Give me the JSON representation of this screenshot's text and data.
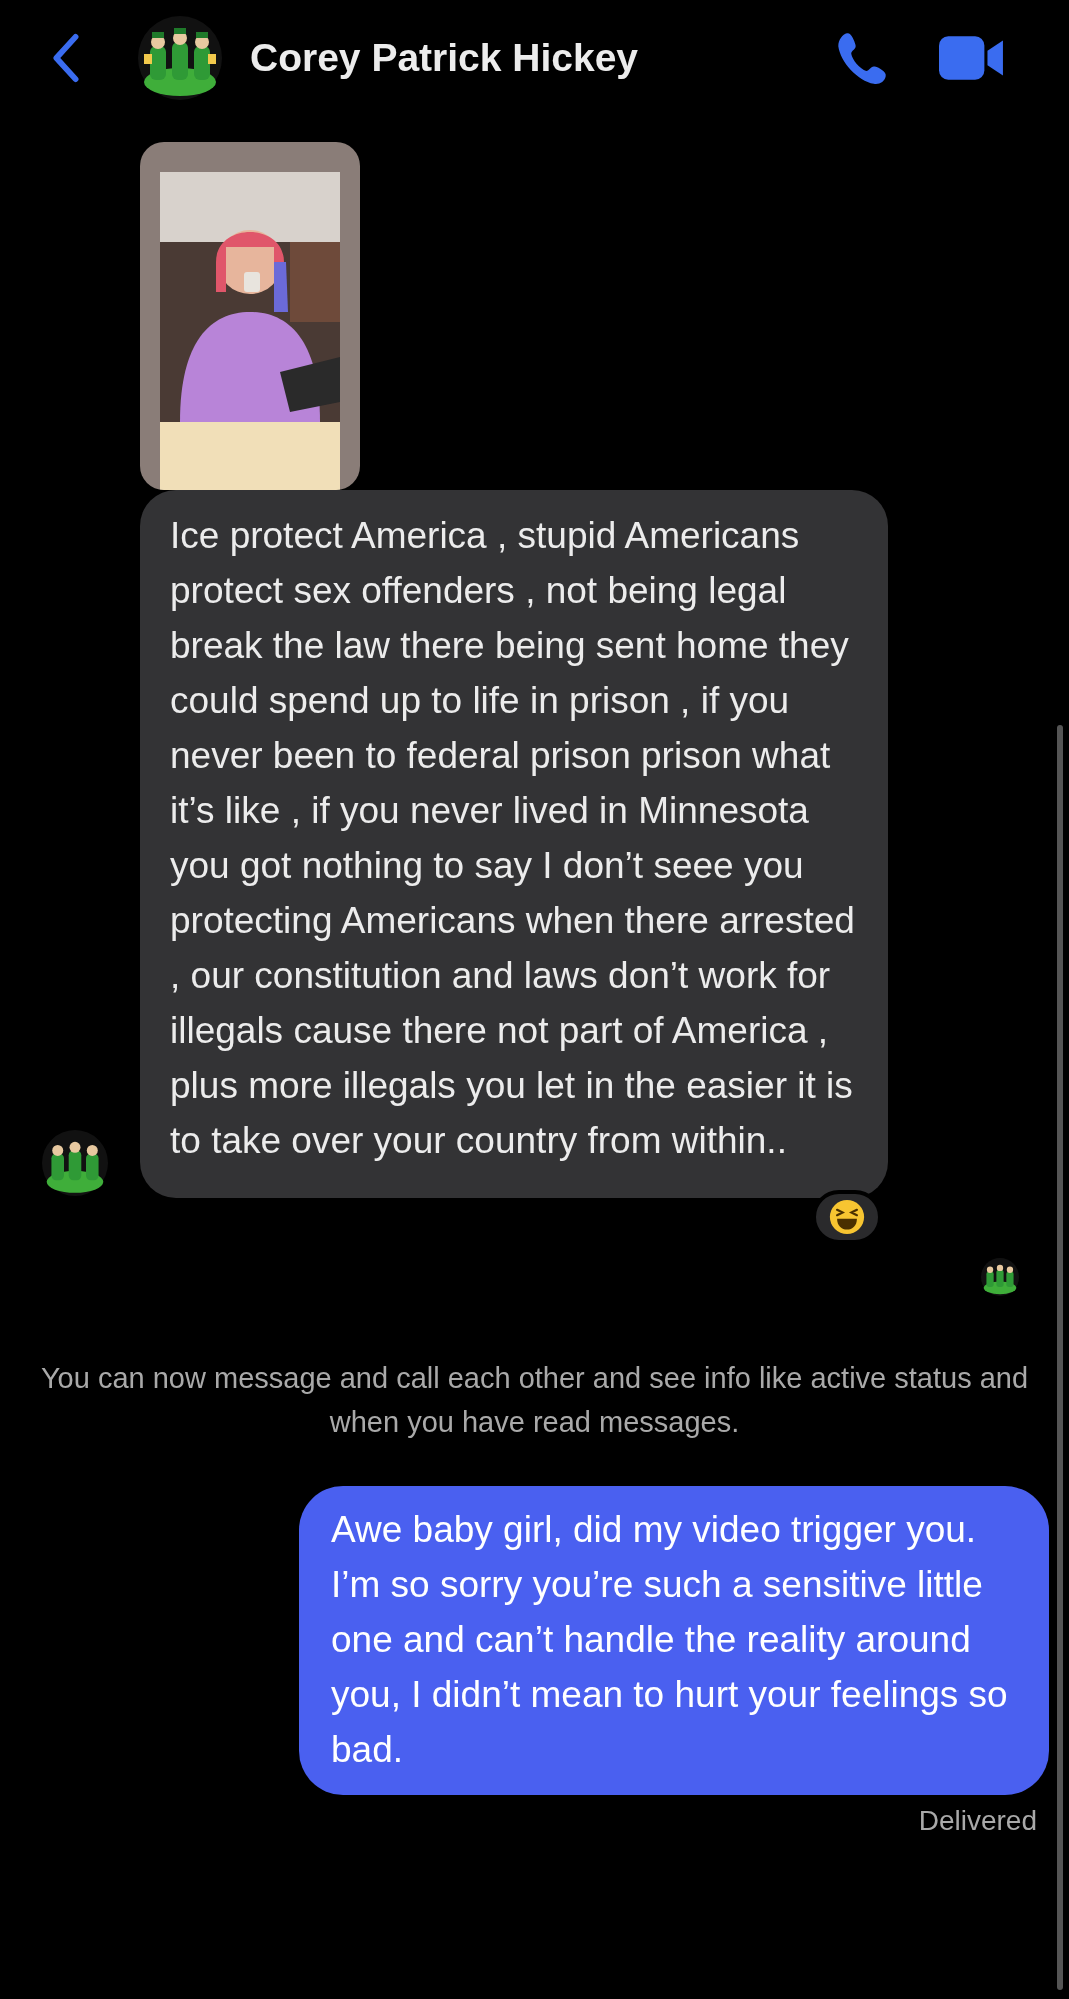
{
  "header": {
    "title": "Corey Patrick Hickey"
  },
  "incoming": {
    "text": "Ice protect America , stupid Americans protect sex offenders , not being legal break the law there being sent home they could spend up to life in prison , if you never been to federal prison prison what it’s like , if you never lived in Minnesota you got nothing to say I don’t seee you protecting Americans when there arrested , our constitution and laws don’t work for illegals cause there not part of America , plus more illegals you let in the easier it is to take over your country from within.."
  },
  "notice": "You can now message and call each other and see info like active status and when you have read messages.",
  "outgoing": {
    "text": "Awe baby girl, did my video trigger you. I’m so sorry you’re such a sensitive little one and can’t handle the reality around you, I didn’t mean to hurt your feelings so bad.",
    "status": "Delivered"
  }
}
